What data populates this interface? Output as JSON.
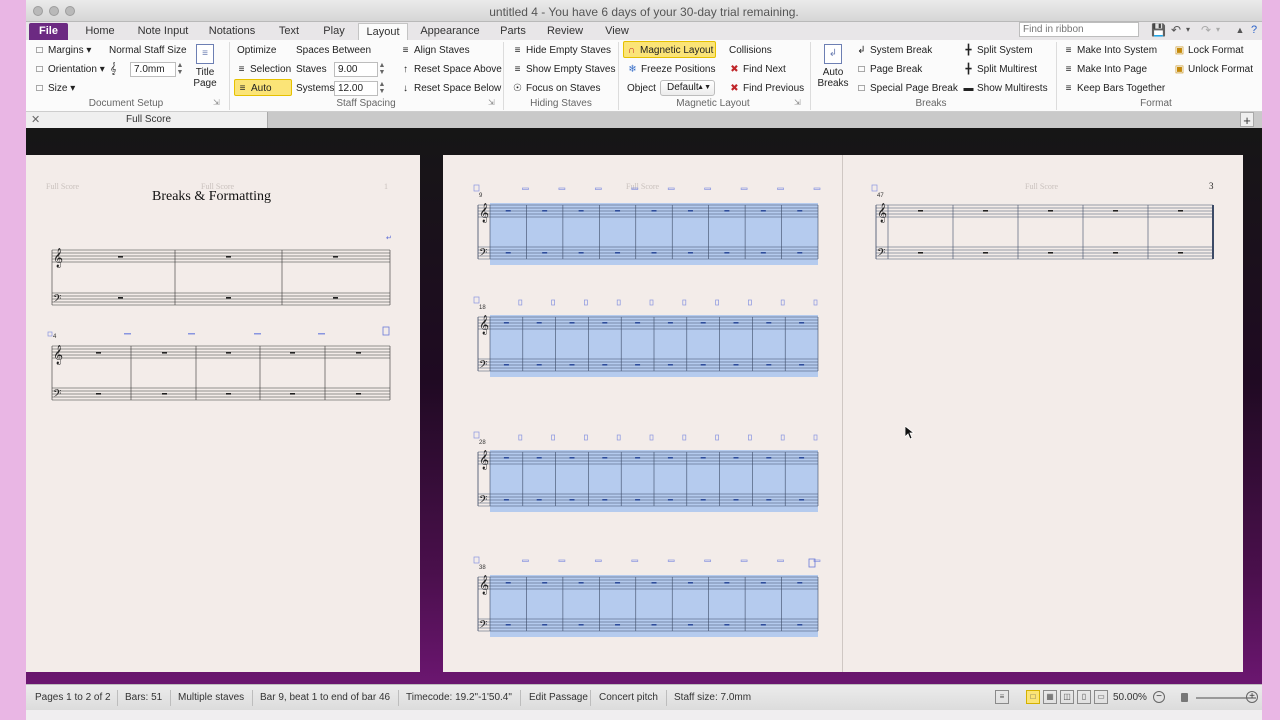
{
  "window": {
    "title": "untitled 4 - You have 6 days of your 30-day trial remaining."
  },
  "ribbon_tabs": [
    {
      "label": "File"
    },
    {
      "label": "Home"
    },
    {
      "label": "Note Input"
    },
    {
      "label": "Notations"
    },
    {
      "label": "Text"
    },
    {
      "label": "Play"
    },
    {
      "label": "Layout"
    },
    {
      "label": "Appearance"
    },
    {
      "label": "Parts"
    },
    {
      "label": "Review"
    },
    {
      "label": "View"
    }
  ],
  "active_tab": "Layout",
  "ribbon_search": {
    "placeholder": "Find in ribbon"
  },
  "document_setup": {
    "margins": "Margins",
    "staff_size_label": "Normal Staff Size",
    "orientation": "Orientation",
    "staff_size_value": "7.0mm",
    "size": "Size",
    "title_page": "Title Page",
    "label": "Document Setup"
  },
  "staff_spacing": {
    "optimize": "Optimize",
    "spaces_between": "Spaces Between",
    "selection": "Selection",
    "staves_label": "Staves",
    "staves_value": "9.00",
    "auto": "Auto",
    "systems_label": "Systems",
    "systems_value": "12.00",
    "align_staves": "Align Staves",
    "reset_above": "Reset Space Above",
    "reset_below": "Reset Space Below",
    "label": "Staff Spacing"
  },
  "hiding_staves": {
    "hide_empty": "Hide Empty Staves",
    "show_empty": "Show Empty Staves",
    "focus": "Focus on Staves",
    "label": "Hiding Staves"
  },
  "magnetic_layout": {
    "magnetic_layout": "Magnetic Layout",
    "collisions": "Collisions",
    "freeze_positions": "Freeze Positions",
    "find_next": "Find Next",
    "object_label": "Object",
    "object_value": "Default",
    "find_previous": "Find Previous",
    "label": "Magnetic Layout"
  },
  "breaks": {
    "auto_breaks": "Auto Breaks",
    "system_break": "System Break",
    "page_break": "Page Break",
    "special_page_break": "Special Page Break",
    "split_system": "Split System",
    "split_multirest": "Split Multirest",
    "show_multirests": "Show Multirests",
    "label": "Breaks"
  },
  "format": {
    "make_into_system": "Make Into System",
    "make_into_page": "Make Into Page",
    "keep_bars_together": "Keep Bars Together",
    "lock_format": "Lock Format",
    "unlock_format": "Unlock Format",
    "label": "Format"
  },
  "document_tab": {
    "label": "Full Score"
  },
  "score": {
    "title": "Breaks & Formatting",
    "header_text": "Full Score",
    "page1_number": "1",
    "page3_number": "3",
    "bar_numbers": {
      "sys2": "4",
      "p2_sys1": "9",
      "p2_sys2": "18",
      "p2_sys3": "28",
      "p2_sys4": "38",
      "p3_sys1": "47"
    }
  },
  "colors": {
    "accent": "#6c2a82",
    "selection": "#a9c6ef",
    "highlight": "#fbe477",
    "page": "#f3ece9"
  },
  "statusbar": {
    "pages": "Pages 1 to 2 of 2",
    "bars": "Bars: 51",
    "staves": "Multiple staves",
    "selection": "Bar 9, beat 1 to end of bar 46",
    "timecode": "Timecode: 19.2\"-1'50.4\"",
    "mode": "Edit Passage",
    "pitch": "Concert pitch",
    "staff_size": "Staff size: 7.0mm",
    "zoom": "50.00%"
  }
}
